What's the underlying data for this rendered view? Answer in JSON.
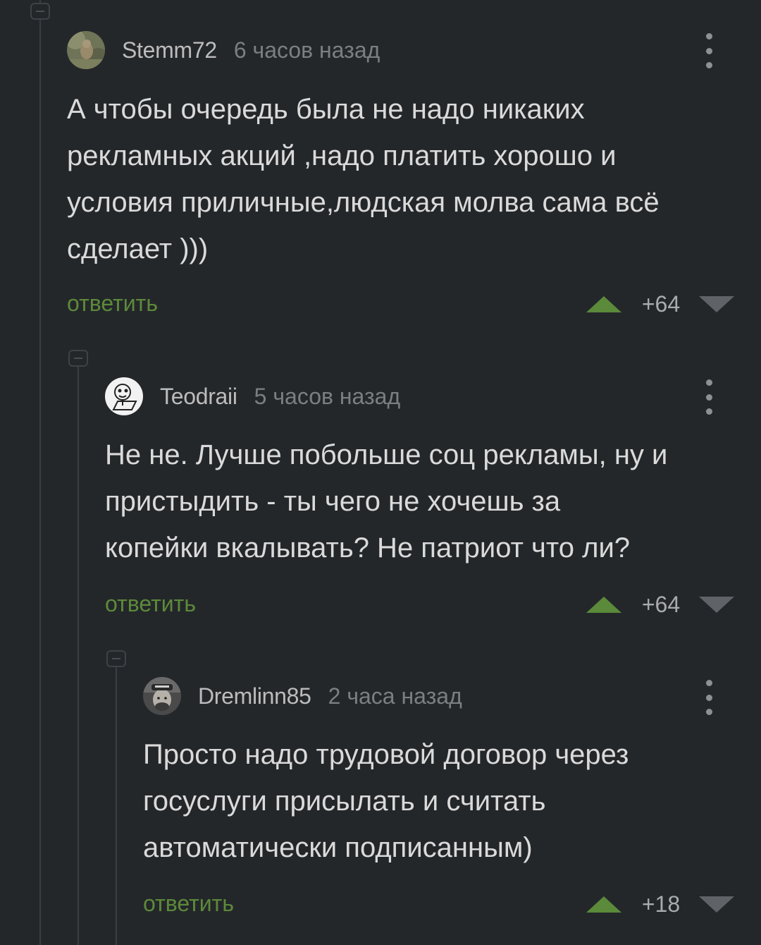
{
  "comments": [
    {
      "username": "Stemm72",
      "time": "6 часов назад",
      "text": "А чтобы очередь была не надо никаких\nрекламных акций ,надо платить хорошо и\nусловия приличные,людская молва сама всё\nсделает )))",
      "reply_label": "ответить",
      "score": "+64",
      "avatar_icon": "squirrel-photo-avatar"
    },
    {
      "username": "Teodraii",
      "time": "5 часов назад",
      "text": "Не не. Лучше побольше соц рекламы, ну и\nпристыдить - ты чего не хочешь за\nкопейки вкалывать? Не патриот что ли?",
      "reply_label": "ответить",
      "score": "+64",
      "avatar_icon": "cartoon-laptop-avatar"
    },
    {
      "username": "Dremlinn85",
      "time": "2 часа назад",
      "text": "Просто надо трудовой договор через\nгосуслуги присылать и считать\nавтоматически подписанным)",
      "reply_label": "ответить",
      "score": "+18",
      "avatar_icon": "man-with-hat-avatar"
    }
  ],
  "colors": {
    "background": "#24272a",
    "reply_link": "#5c8a3a",
    "upvote": "#5a8a3a",
    "downvote": "#5f6367"
  }
}
